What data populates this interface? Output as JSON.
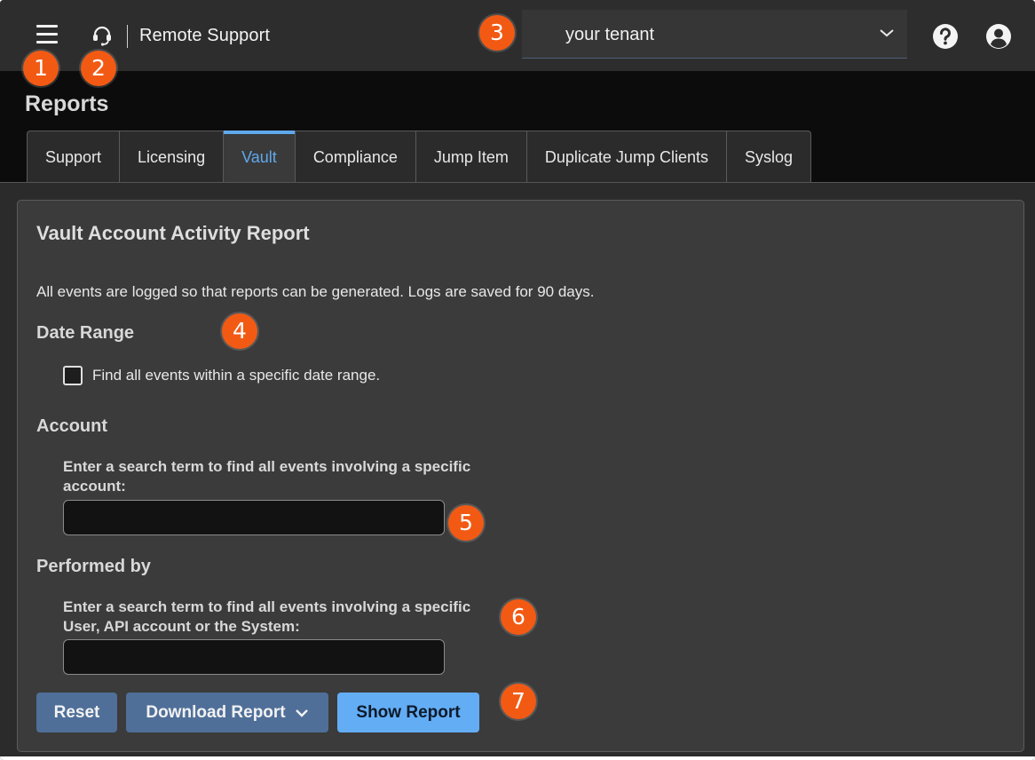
{
  "header": {
    "app_title": "Remote Support",
    "tenant_value": "your tenant",
    "icons": [
      "menu-icon",
      "headset-icon",
      "chevron-down-icon",
      "help-icon",
      "user-icon"
    ]
  },
  "callouts": [
    "1",
    "2",
    "3",
    "4",
    "5",
    "6",
    "7"
  ],
  "page": {
    "title": "Reports",
    "tabs": [
      {
        "label": "Support",
        "active": false
      },
      {
        "label": "Licensing",
        "active": false
      },
      {
        "label": "Vault",
        "active": true
      },
      {
        "label": "Compliance",
        "active": false
      },
      {
        "label": "Jump Item",
        "active": false
      },
      {
        "label": "Duplicate Jump Clients",
        "active": false
      },
      {
        "label": "Syslog",
        "active": false
      }
    ]
  },
  "panel": {
    "title": "Vault Account Activity Report",
    "description": "All events are logged so that reports can be generated. Logs are saved for 90 days.",
    "date_range": {
      "heading": "Date Range",
      "checkbox_label": "Find all events within a specific date range.",
      "checked": false
    },
    "account": {
      "heading": "Account",
      "field_label": "Enter a search term to find all events involving a specific account:",
      "value": ""
    },
    "performed_by": {
      "heading": "Performed by",
      "field_label": "Enter a search term to find all events involving a specific User, API account or the System:",
      "value": ""
    },
    "buttons": {
      "reset": "Reset",
      "download": "Download Report",
      "show": "Show Report"
    }
  },
  "colors": {
    "accent": "#5fa8ec",
    "callout": "#f25a14",
    "button": "#4f6f99",
    "primary_button": "#63adf5"
  }
}
